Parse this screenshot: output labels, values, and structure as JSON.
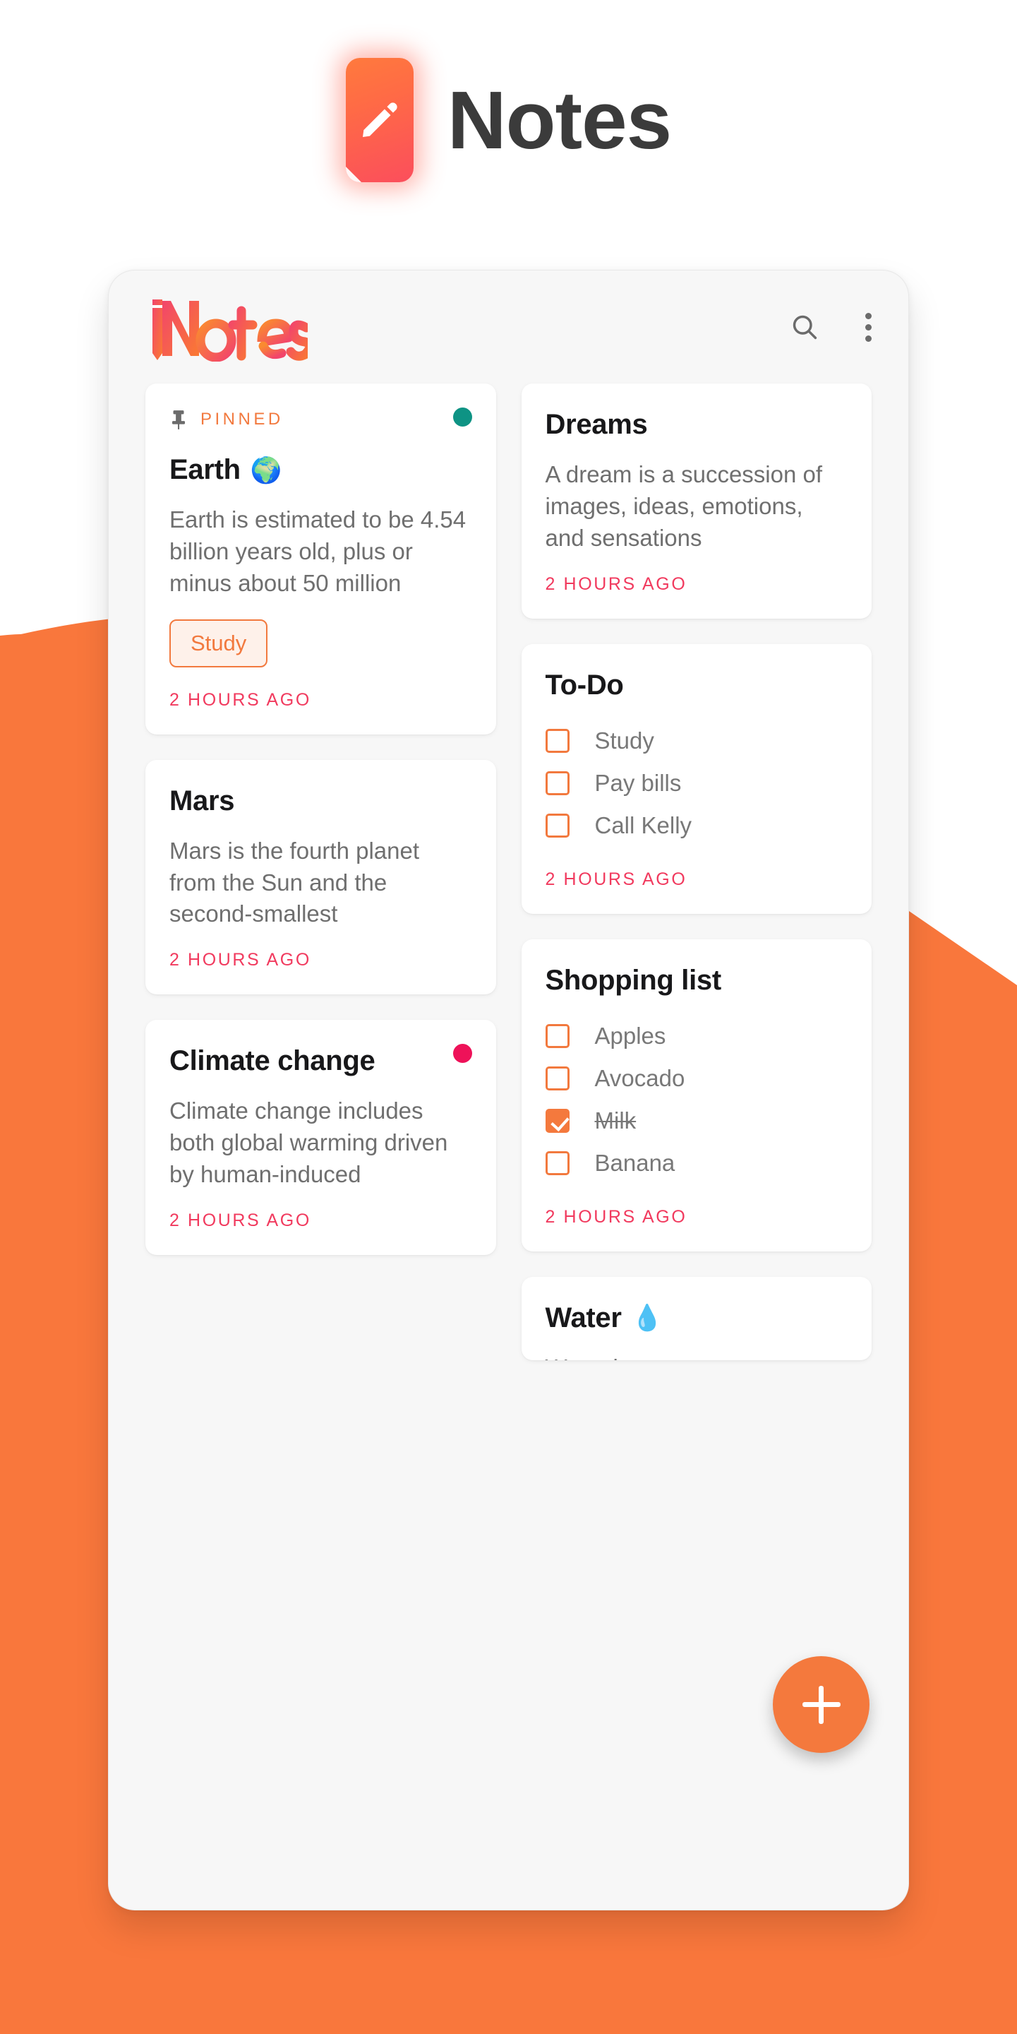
{
  "app": {
    "title": "Notes",
    "icon_name": "pencil-icon",
    "icon_gradient_from": "#FF7A3D",
    "icon_gradient_to": "#FB4E5C"
  },
  "colors": {
    "background_orange": "#F9773C",
    "accent_orange": "#F4793D",
    "tag_orange": "#F2793E",
    "timestamp_pink": "#F13A5E",
    "teal_dot": "#0E9384",
    "pink_dot": "#EE1259",
    "body_gray": "#6f6f6f",
    "title_black": "#18181a"
  },
  "phone": {
    "brand": "Notes",
    "search_icon": "search-icon",
    "overflow_icon": "more-vertical-icon",
    "fab_icon": "plus-icon",
    "fab_label": "+"
  },
  "notes": {
    "left_column": [
      {
        "id": "earth",
        "pinned": true,
        "pin_icon": "pin-icon",
        "pinned_label": "PINNED",
        "dot_color": "#0E9384",
        "title": "Earth",
        "emoji": "🌍",
        "body": "Earth is estimated to be 4.54 billion years old, plus or minus about 50 million",
        "tag": "Study",
        "timestamp": "2 HOURS AGO"
      },
      {
        "id": "mars",
        "pinned": false,
        "dot_color": null,
        "title": "Mars",
        "emoji": "",
        "body": "Mars is the fourth planet from the Sun and the second-smallest",
        "tag": null,
        "timestamp": "2 HOURS AGO"
      },
      {
        "id": "climate-change",
        "pinned": false,
        "dot_color": "#EE1259",
        "title": "Climate change",
        "emoji": "",
        "body": "Climate change includes both global warming driven by human-induced",
        "tag": null,
        "timestamp": "2 HOURS AGO"
      }
    ],
    "right_column": [
      {
        "id": "dreams",
        "title": "Dreams",
        "emoji": "",
        "body": "A dream is a succession of images, ideas, emotions, and sensations",
        "timestamp": "2 HOURS AGO"
      },
      {
        "id": "todo",
        "title": "To-Do",
        "emoji": "",
        "items": [
          {
            "label": "Study",
            "checked": false
          },
          {
            "label": "Pay bills",
            "checked": false
          },
          {
            "label": "Call Kelly",
            "checked": false
          }
        ],
        "timestamp": "2 HOURS AGO"
      },
      {
        "id": "shopping-list",
        "title": "Shopping list",
        "emoji": "",
        "items": [
          {
            "label": "Apples",
            "checked": false
          },
          {
            "label": "Avocado",
            "checked": false
          },
          {
            "label": "Milk",
            "checked": true
          },
          {
            "label": "Banana",
            "checked": false
          }
        ],
        "timestamp": "2 HOURS AGO"
      },
      {
        "id": "water",
        "title": "Water",
        "emoji": "💧",
        "body": "Water is an",
        "clipped": true
      }
    ]
  }
}
